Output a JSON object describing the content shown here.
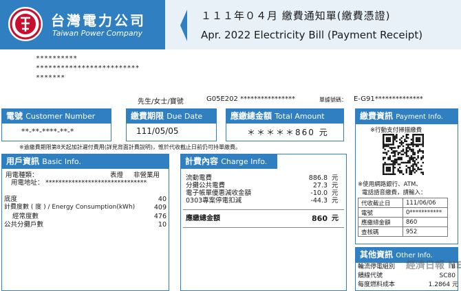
{
  "header": {
    "company_zh": "台灣電力公司",
    "company_en": "Taiwan Power Company",
    "title_zh": "１１１年０４月 繳費通知單(繳費憑證)",
    "title_en": "Apr. 2022 Electricity Bill (Payment Receipt)"
  },
  "address": {
    "line1": "**********",
    "line2": "*************************",
    "line3": "*******"
  },
  "customer": {
    "name_label": "先生/女士/寶號",
    "name_value": "G05E202 ****************",
    "doc_label": "單據號碼：",
    "doc_value": "E-G91**************"
  },
  "summary": {
    "number_label_zh": "電號",
    "number_label_en": "Customer Number",
    "number_value": "**-**-****-**-*",
    "due_label_zh": "繳費期限",
    "due_label_en": "Due Date",
    "due_value": "111/05/05",
    "total_label_zh": "應繳總金額",
    "total_label_en": "Total Amount",
    "total_value": "＊＊＊＊＊860 元"
  },
  "notice": "※逾繳費期限第8天起加計遲付費用(詳見背面計費說明)，惟於代收截止日前仍可持單繳費。",
  "basic": {
    "heading_zh": "用戶資訊",
    "heading_en": "Basic Info.",
    "type_label": "用電種類：",
    "type_value1": "表燈",
    "type_value2": "非營業用",
    "addr_label": "用電地址：",
    "addr_value": "*******************************",
    "rows": [
      {
        "label": "底度",
        "value": "40"
      },
      {
        "label": "計費度數 ( 度 ) / Energy Consumption(kWh)",
        "value": "409"
      },
      {
        "label": "經常度數",
        "value": "476"
      },
      {
        "label": "公共分攤戶數",
        "value": "10"
      }
    ]
  },
  "charge": {
    "heading_zh": "計費內容",
    "heading_en": "Charge Info.",
    "items": [
      {
        "label": "流動電費",
        "value": "886.8",
        "unit": "元"
      },
      {
        "label": "分攤公共電費",
        "value": "27.3",
        "unit": "元"
      },
      {
        "label": "電子帳單優惠減收金額",
        "value": "-10.0",
        "unit": "元"
      },
      {
        "label": "0303專案停電扣減",
        "value": "-44.3",
        "unit": "元"
      }
    ],
    "total_label": "應繳總金額",
    "total_value": "860",
    "total_unit": "元"
  },
  "payment": {
    "heading_zh": "繳費資訊",
    "heading_en": "Payment Info.",
    "qr_caption": "※行動支付掃描繳費",
    "bank_note_1": "※使用網路銀行、ATM、",
    "bank_note_2": "電話語音繳費，請輸入：",
    "table": [
      {
        "label": "代收截止日",
        "value": "111/06/06"
      },
      {
        "label": "電號",
        "value": "0***********"
      },
      {
        "label": "應繳總金額",
        "value": "860"
      },
      {
        "label": "查核碼",
        "value": "952"
      }
    ]
  },
  "other": {
    "heading_zh": "其他資訊",
    "heading_en": "Other Info.",
    "rows": [
      {
        "label": "輪流停電組別",
        "value": "B"
      },
      {
        "label": "饋線代號",
        "value": "SC80"
      },
      {
        "label": "每度燃料成本",
        "value": "1.2864 元"
      }
    ]
  },
  "watermark": "經濟日報 NEWS",
  "colors": {
    "accent": "#2f7fc1",
    "brand_red": "#c8102e"
  }
}
